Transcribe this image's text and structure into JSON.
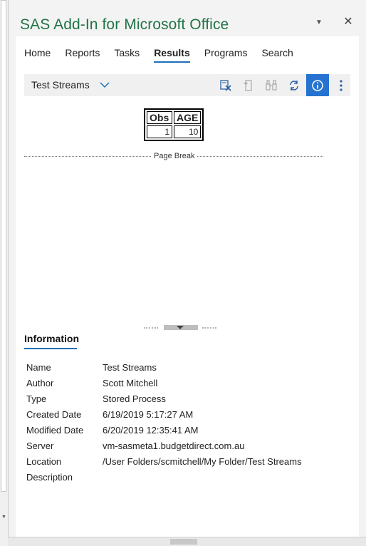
{
  "pane": {
    "title": "SAS Add-In for Microsoft Office",
    "menu_icon": "dropdown-triangle-icon",
    "close_icon": "close-icon"
  },
  "tabs": [
    {
      "label": "Home",
      "active": false
    },
    {
      "label": "Reports",
      "active": false
    },
    {
      "label": "Tasks",
      "active": false
    },
    {
      "label": "Results",
      "active": true
    },
    {
      "label": "Programs",
      "active": false
    },
    {
      "label": "Search",
      "active": false
    }
  ],
  "toolbar": {
    "selected_result": "Test Streams",
    "buttons": [
      {
        "icon": "clear-results-icon",
        "active": false
      },
      {
        "icon": "open-document-icon",
        "active": false
      },
      {
        "icon": "binoculars-icon",
        "active": false
      },
      {
        "icon": "refresh-icon",
        "active": false
      },
      {
        "icon": "info-icon",
        "active": true
      },
      {
        "icon": "more-vertical-icon",
        "active": false
      }
    ],
    "accent_color": "#2672d1"
  },
  "result_table": {
    "headers": [
      "Obs",
      "AGE"
    ],
    "rows": [
      [
        "1",
        "10"
      ]
    ]
  },
  "page_break_label": "Page Break",
  "information": {
    "header": "Information",
    "fields": [
      {
        "label": "Name",
        "value": "Test Streams"
      },
      {
        "label": "Author",
        "value": "Scott Mitchell"
      },
      {
        "label": "Type",
        "value": "Stored Process"
      },
      {
        "label": "Created Date",
        "value": "6/19/2019 5:17:27 AM"
      },
      {
        "label": "Modified Date",
        "value": "6/20/2019 12:35:41 AM"
      },
      {
        "label": "Server",
        "value": "vm-sasmeta1.budgetdirect.com.au"
      },
      {
        "label": "Location",
        "value": "/User Folders/scmitchell/My Folder/Test Streams"
      },
      {
        "label": "Description",
        "value": ""
      }
    ]
  },
  "colors": {
    "title_green": "#217346",
    "tab_underline": "#1f6fb8"
  }
}
